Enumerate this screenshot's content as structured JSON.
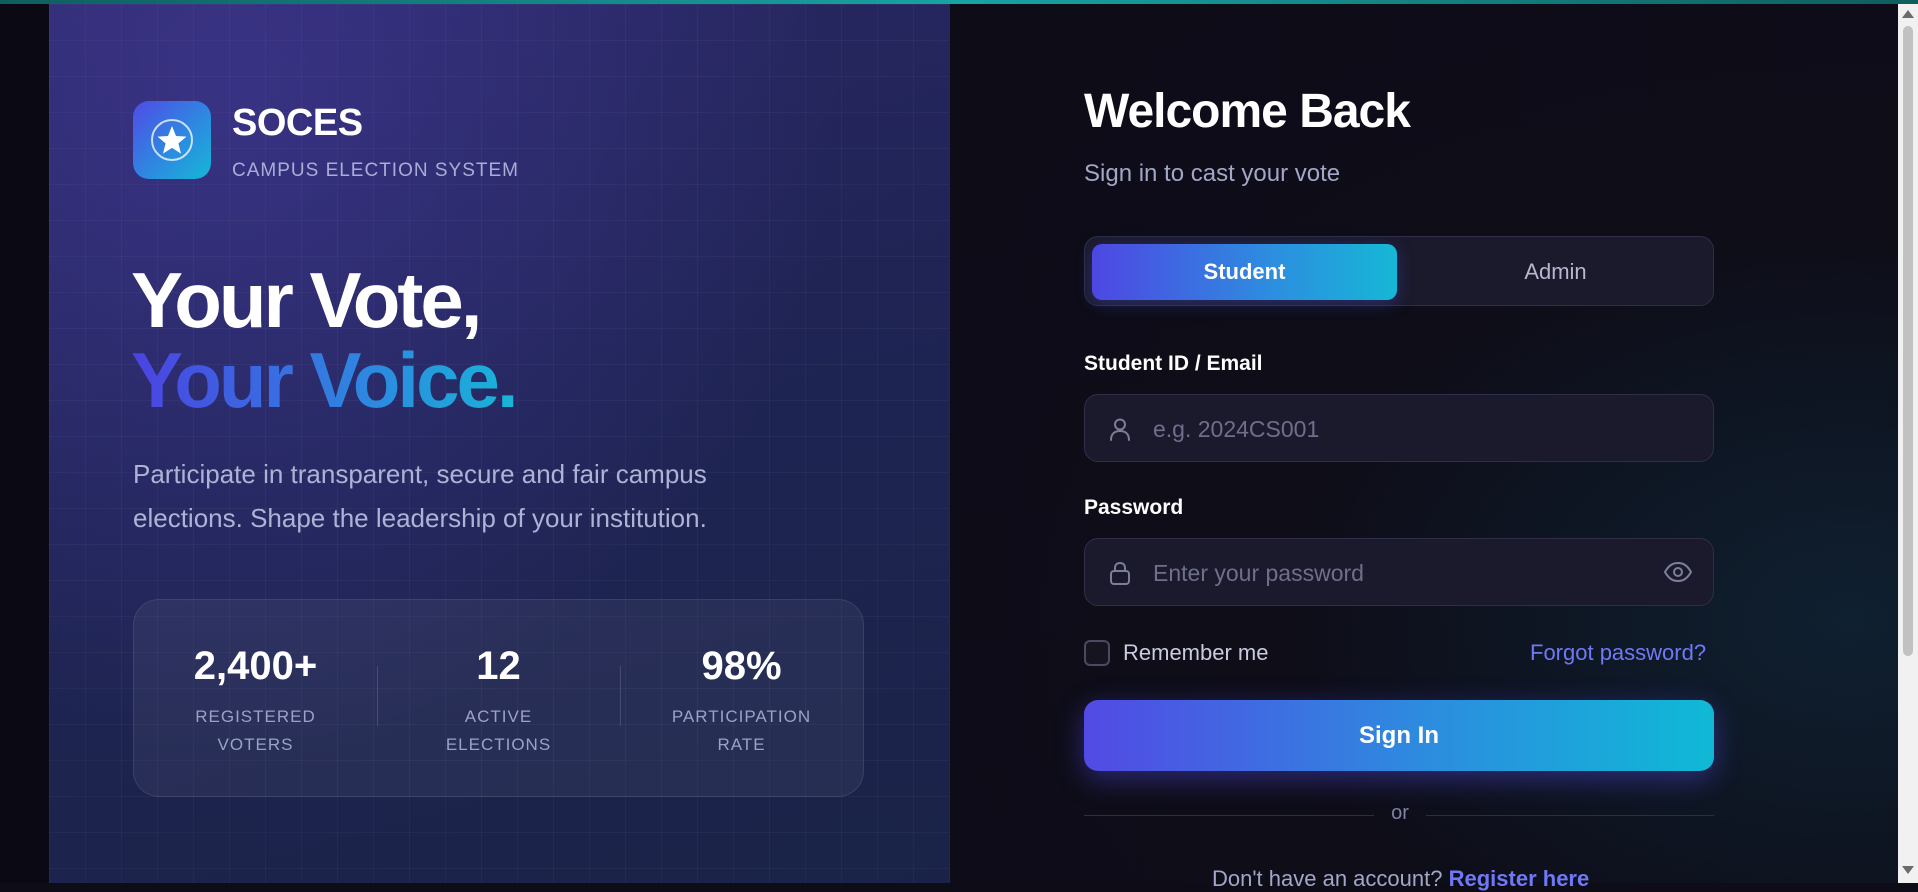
{
  "brand": {
    "name": "SOCES",
    "subtitle": "CAMPUS ELECTION SYSTEM"
  },
  "hero": {
    "line1": "Your Vote,",
    "line2": "Your Voice.",
    "description": "Participate in transparent, secure and fair campus elections. Shape the leadership of your institution."
  },
  "stats": [
    {
      "value": "2,400+",
      "label": "REGISTERED VOTERS"
    },
    {
      "value": "12",
      "label": "ACTIVE ELECTIONS"
    },
    {
      "value": "98%",
      "label": "PARTICIPATION RATE"
    }
  ],
  "form": {
    "title": "Welcome Back",
    "subtitle": "Sign in to cast your vote",
    "roles": {
      "student": "Student",
      "admin": "Admin",
      "selected": "Student"
    },
    "id_label": "Student ID / Email",
    "id_placeholder": "e.g. 2024CS001",
    "id_value": "",
    "password_label": "Password",
    "password_placeholder": "Enter your password",
    "password_value": "",
    "remember_label": "Remember me",
    "remember_checked": false,
    "forgot_label": "Forgot password?",
    "signin_label": "Sign In",
    "or_label": "or",
    "register_prompt": "Don't have an account?",
    "register_link": "Register here"
  },
  "icons": {
    "logo": "star-icon",
    "id_field": "user-icon",
    "password_field": "lock-icon",
    "password_toggle": "eye-icon"
  },
  "colors": {
    "accent_start": "#4f46e5",
    "accent_end": "#0fb9d6",
    "link": "#6f79f5",
    "background": "#0d0c17"
  }
}
